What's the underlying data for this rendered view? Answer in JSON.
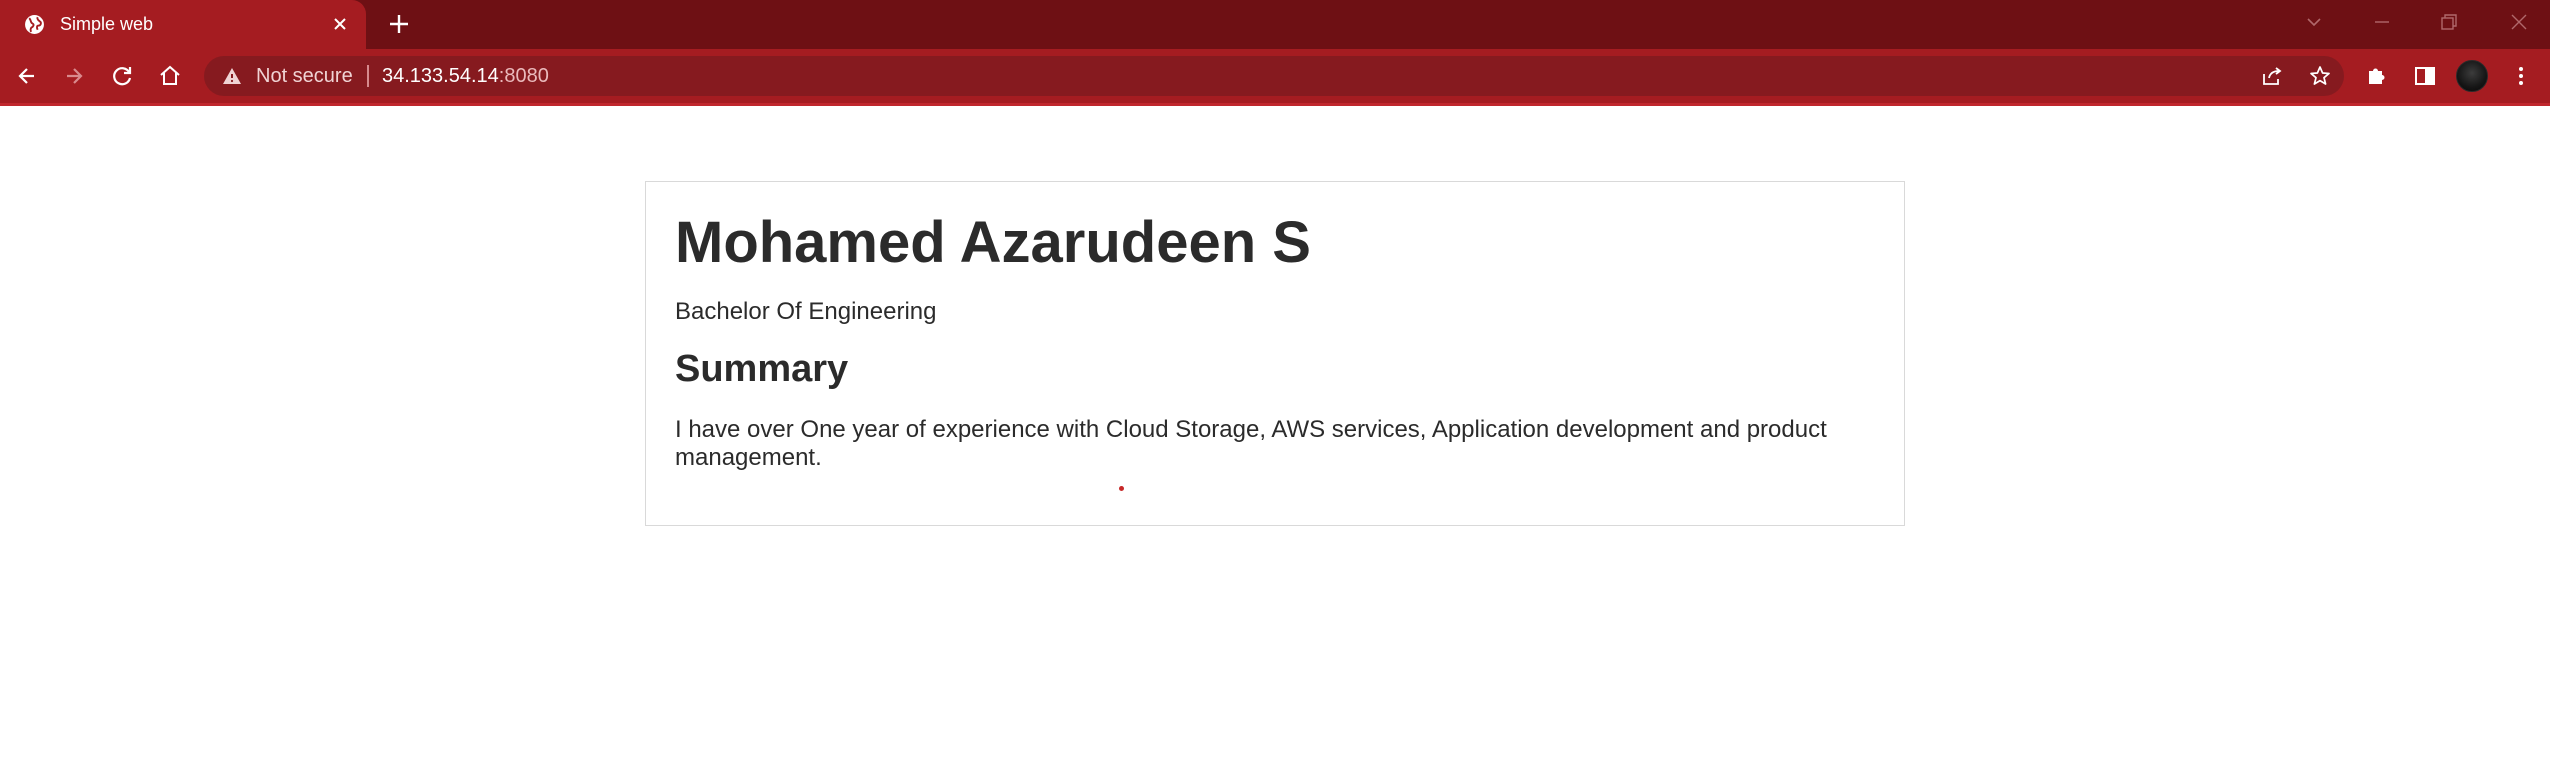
{
  "browser": {
    "tab": {
      "title": "Simple web",
      "favicon": "globe-icon"
    },
    "address_bar": {
      "security_label": "Not secure",
      "url_host": "34.133.54.14",
      "url_port": ":8080"
    },
    "theme_colors": {
      "frame": "#6e1014",
      "toolbar": "#a51c21",
      "omnibox": "#861a1f"
    },
    "toolbar_icons": [
      "back-icon",
      "forward-icon",
      "reload-icon",
      "home-icon",
      "share-icon",
      "bookmark-star-icon",
      "extensions-icon",
      "side-panel-icon",
      "profile-avatar",
      "menu-icon"
    ],
    "window_controls": [
      "tab-search-icon",
      "minimize-icon",
      "restore-icon",
      "close-window-icon"
    ]
  },
  "page": {
    "name": "Mohamed Azarudeen S",
    "degree": "Bachelor Of Engineering",
    "summary_heading": "Summary",
    "summary_text": "I have over One year of experience with Cloud Storage, AWS services, Application development and product management."
  }
}
